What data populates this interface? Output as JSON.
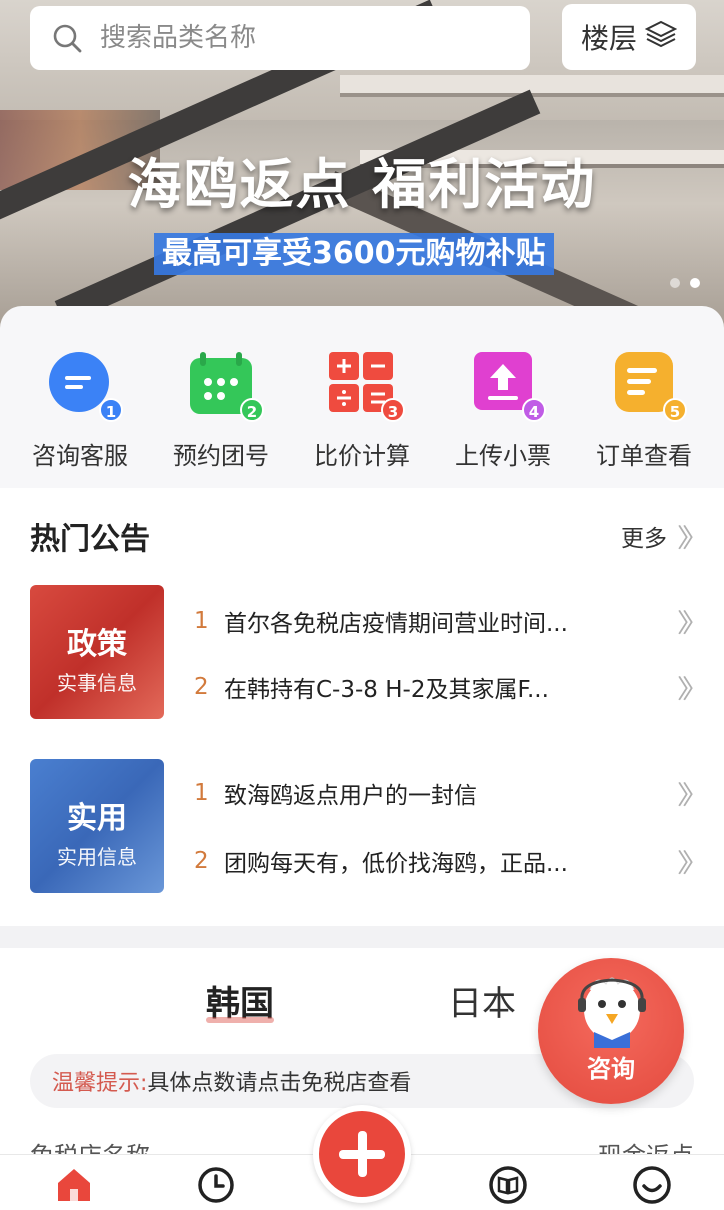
{
  "search": {
    "placeholder": "搜索品类名称"
  },
  "floor_button": {
    "label": "楼层"
  },
  "banner": {
    "title": "海鸥返点 福利活动",
    "subtitle": "最高可享受3600元购物补贴",
    "slide_count": 2,
    "active_slide": 2
  },
  "quick_actions": [
    {
      "label": "咨询客服",
      "num": "1",
      "icon": "chat-bubble-icon",
      "color": "#3b82f6"
    },
    {
      "label": "预约团号",
      "num": "2",
      "icon": "calendar-icon",
      "color": "#34c759"
    },
    {
      "label": "比价计算",
      "num": "3",
      "icon": "calculator-icon",
      "color": "#ef4b3f"
    },
    {
      "label": "上传小票",
      "num": "4",
      "icon": "upload-icon",
      "color": "#e040d0"
    },
    {
      "label": "订单查看",
      "num": "5",
      "icon": "order-list-icon",
      "color": "#f5b02e"
    }
  ],
  "notice": {
    "title": "热门公告",
    "more": "更多",
    "groups": [
      {
        "tag_big": "政策",
        "tag_small": "实事信息",
        "items": [
          {
            "idx": "1",
            "text": "首尔各免税店疫情期间营业时间..."
          },
          {
            "idx": "2",
            "text": "在韩持有C-3-8 H-2及其家属F..."
          }
        ]
      },
      {
        "tag_big": "实用",
        "tag_small": "实用信息",
        "items": [
          {
            "idx": "1",
            "text": "致海鸥返点用户的一封信"
          },
          {
            "idx": "2",
            "text": "团购每天有，低价找海鸥，正品..."
          }
        ]
      }
    ]
  },
  "country_tabs": {
    "korea": "韩国",
    "japan": "日本"
  },
  "tip": {
    "label": "温馨提示:",
    "text": "具体点数请点击免税店查看"
  },
  "columns": {
    "left": "免税店名称",
    "right": "现金返点"
  },
  "consult": {
    "label": "咨询"
  }
}
